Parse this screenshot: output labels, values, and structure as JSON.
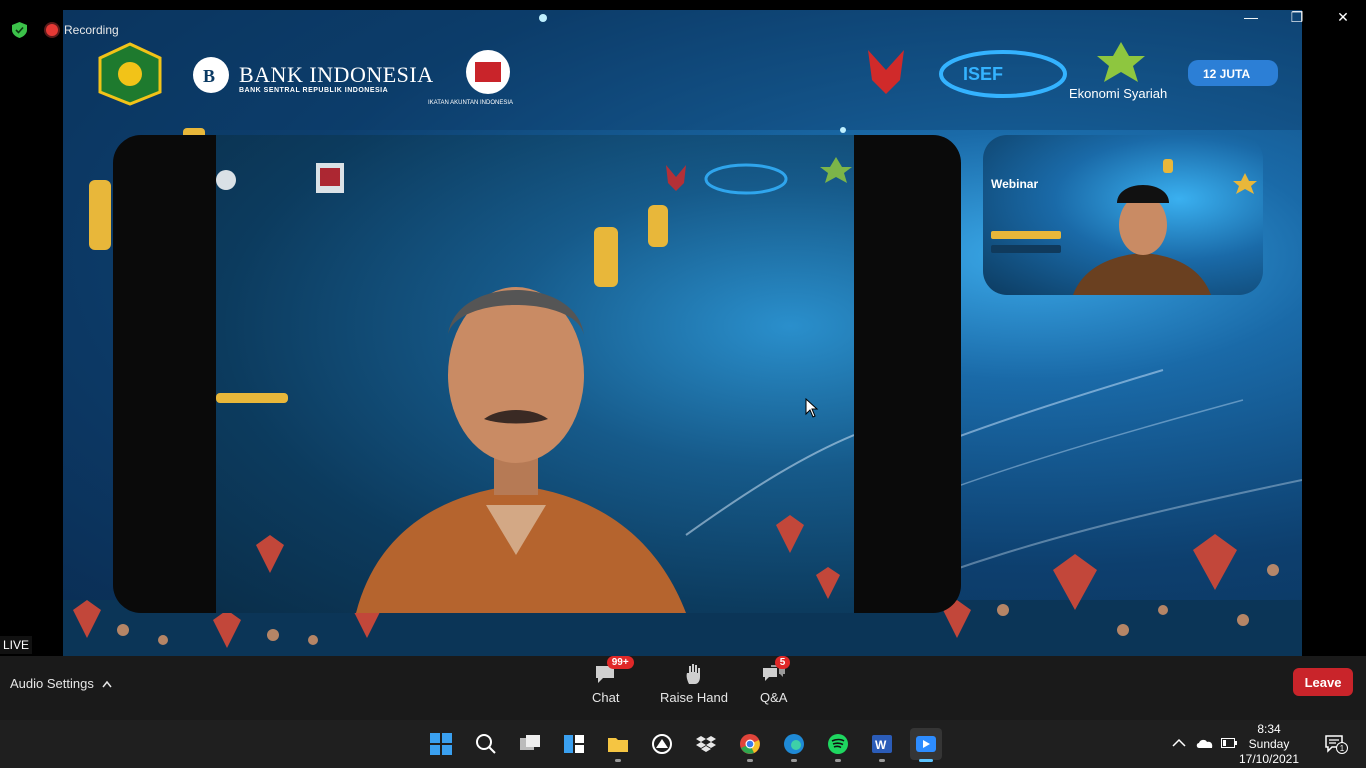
{
  "titlebar": {
    "recording_label": "Recording",
    "minimize": "—",
    "restore": "❐",
    "close": "✕"
  },
  "stage": {
    "bank_title": "BANK INDONESIA",
    "bank_subtitle": "BANK SENTRAL REPUBLIK INDONESIA",
    "iai_subtitle": "IKATAN AKUNTAN INDONESIA",
    "eko_label": "Ekonomi Syariah",
    "live_label": "LIVE",
    "thumb_webinar": "Webinar"
  },
  "toolbar": {
    "audio_settings": "Audio Settings",
    "chat_label": "Chat",
    "chat_badge": "99+",
    "raise_hand_label": "Raise Hand",
    "qa_label": "Q&A",
    "qa_badge": "5",
    "leave_label": "Leave"
  },
  "taskbar": {
    "time": "8:34",
    "day": "Sunday",
    "date": "17/10/2021",
    "notif_count": "1"
  },
  "colors": {
    "leave_bg": "#c9242a",
    "badge_bg": "#e02828",
    "toolbar_bg": "#1a1a1a",
    "taskbar_bg": "#1f1f1f"
  }
}
